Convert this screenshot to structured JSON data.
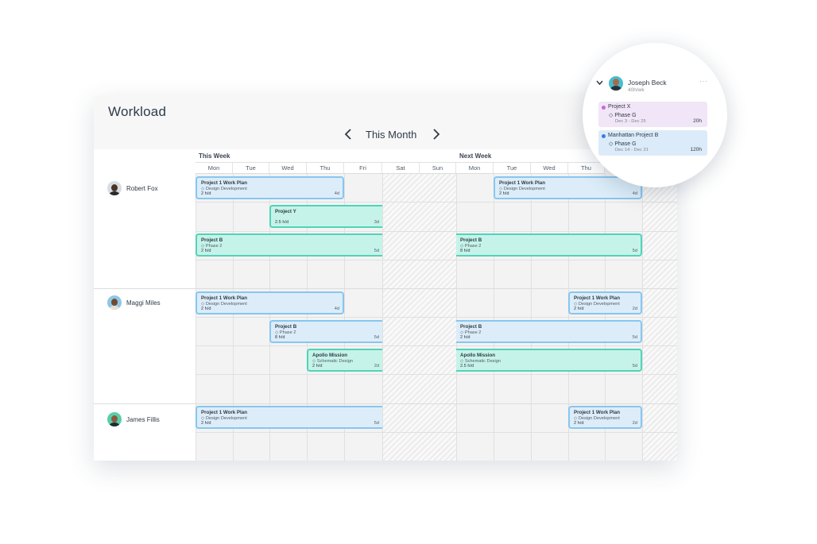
{
  "title": "Workload",
  "period_label": "This Month",
  "weeks": [
    "This Week",
    "Next Week"
  ],
  "days": [
    "Mon",
    "Tue",
    "Wed",
    "Thu",
    "Fri",
    "Sat",
    "Sun",
    "Mon",
    "Tue",
    "Wed",
    "Thu"
  ],
  "people": [
    {
      "name": "Robert Fox",
      "tasks": [
        {
          "name": "Project 1 Work Plan",
          "phase": "◇ Design Development",
          "hours": "2 h/d",
          "days": "4d",
          "color": "blue"
        },
        {
          "name": "Project 1 Work Plan",
          "phase": "◇ Design Development",
          "hours": "2 h/d",
          "days": "4d",
          "color": "blue"
        },
        {
          "name": "Project Y",
          "phase": "",
          "hours": "2.5 h/d",
          "days": "3d",
          "color": "green"
        },
        {
          "name": "Project B",
          "phase": "◇ Phase 2",
          "hours": "2 h/d",
          "days": "5d",
          "color": "green"
        },
        {
          "name": "Project B",
          "phase": "◇ Phase 2",
          "hours": "8 h/d",
          "days": "5d",
          "color": "green"
        }
      ]
    },
    {
      "name": "Maggi Miles",
      "tasks": [
        {
          "name": "Project 1 Work Plan",
          "phase": "◇ Design Development",
          "hours": "2 h/d",
          "days": "4d",
          "color": "blue"
        },
        {
          "name": "Project 1 Work Plan",
          "phase": "◇ Design Development",
          "hours": "2 h/d",
          "days": "2d",
          "color": "blue"
        },
        {
          "name": "Project B",
          "phase": "◇ Phase 2",
          "hours": "8 h/d",
          "days": "5d",
          "color": "blue"
        },
        {
          "name": "Project B",
          "phase": "◇ Phase 2",
          "hours": "2 h/d",
          "days": "5d",
          "color": "blue"
        },
        {
          "name": "Apollo Mission",
          "phase": "◇ Schematic Design",
          "hours": "2 h/d",
          "days": "2d",
          "color": "green"
        },
        {
          "name": "Apollo Mission",
          "phase": "◇ Schematic Design",
          "hours": "2.5 h/d",
          "days": "5d",
          "color": "green"
        }
      ]
    },
    {
      "name": "James Fillis",
      "tasks": [
        {
          "name": "Project 1 Work Plan",
          "phase": "◇ Design Development",
          "hours": "2 h/d",
          "days": "5d",
          "color": "blue"
        },
        {
          "name": "Project 1 Work Plan",
          "phase": "◇ Design Development",
          "hours": "2 h/d",
          "days": "2d",
          "color": "blue"
        }
      ]
    }
  ],
  "popup": {
    "name": "Joseph Beck",
    "capacity": "40h/wk",
    "more": "···",
    "projects": [
      {
        "name": "Project X",
        "phase": "◇ Phase G",
        "dates": "Dec 3 - Dec 25",
        "hours": "20h",
        "color": "#c86ad8",
        "bg": "#f1e6f7"
      },
      {
        "name": "Manhattan Project B",
        "phase": "◇ Phase G",
        "dates": "Dec 14 - Dec 21",
        "hours": "120h",
        "color": "#3b7be0",
        "bg": "#dcebf9"
      }
    ]
  },
  "icons": {
    "prev": "chevron-left-icon",
    "next": "chevron-right-icon",
    "collapse": "chevron-down-icon"
  },
  "colors": {
    "blue_border": "#88c6ef",
    "blue_fill": "#dcedf9",
    "green_border": "#52d3b9",
    "green_fill": "#c6f3e9"
  }
}
